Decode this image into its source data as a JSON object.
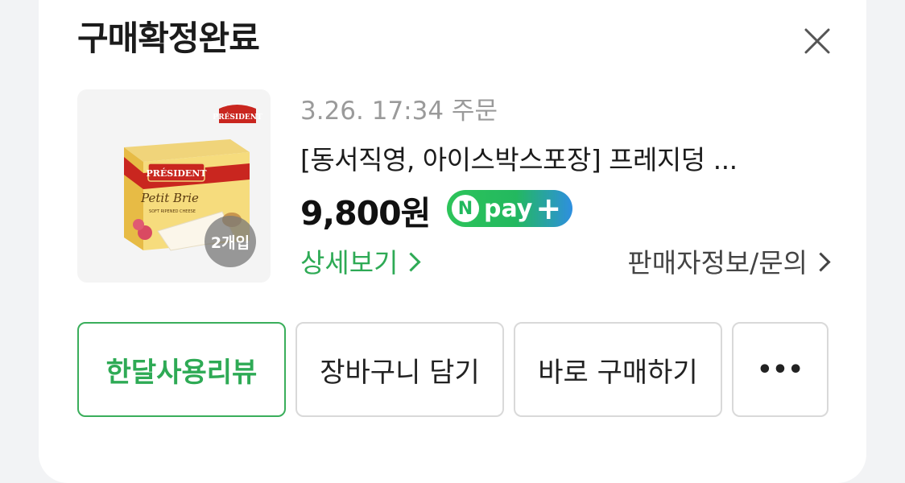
{
  "header": {
    "title": "구매확정완료"
  },
  "order": {
    "date": "3.26. 17:34 주문",
    "product_name": "[동서직영, 아이스박스포장] 프레지덩 ...",
    "price": "9,800원",
    "quantity_badge": "2개입",
    "thumbnail": {
      "brand": "PRÉSIDENT",
      "product": "Petit Brie",
      "subtitle": "SOFT RIPENED CHEESE"
    },
    "npay": {
      "n": "N",
      "text": "pay",
      "plus": "+"
    }
  },
  "links": {
    "detail": "상세보기",
    "seller": "판매자정보/문의"
  },
  "actions": {
    "review": "한달사용리뷰",
    "cart": "장바구니 담기",
    "buy": "바로 구매하기",
    "more": "•••"
  },
  "icons": {
    "close": "close-icon",
    "chevron": "chevron-right-icon"
  },
  "colors": {
    "accent_green": "#2eaa55",
    "npay_green": "#23b85f",
    "npay_blue": "#2e8fe0"
  }
}
